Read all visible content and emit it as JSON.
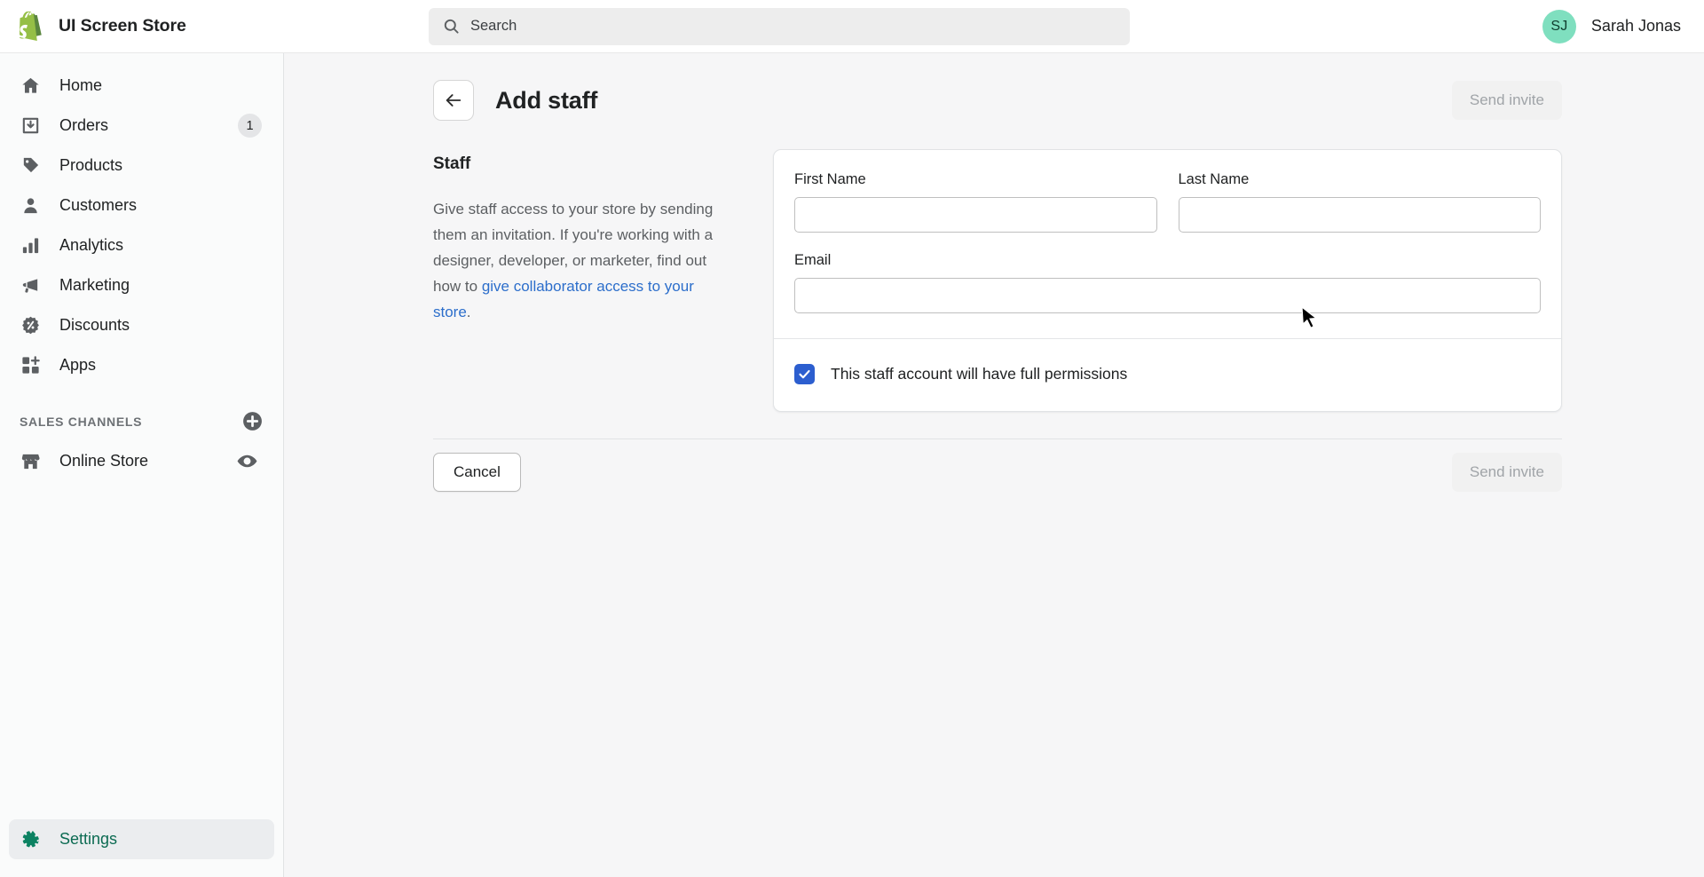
{
  "topbar": {
    "brand_name": "UI Screen Store",
    "logo_icon": "shopify-bag-icon",
    "search": {
      "placeholder": "Search",
      "value": "",
      "icon": "search-icon"
    },
    "user": {
      "initials": "SJ",
      "name": "Sarah Jonas",
      "avatar_color": "#7fdfbf"
    }
  },
  "sidebar": {
    "items": [
      {
        "label": "Home",
        "icon": "home-icon",
        "badge": null
      },
      {
        "label": "Orders",
        "icon": "orders-inbox-icon",
        "badge": "1"
      },
      {
        "label": "Products",
        "icon": "tag-icon",
        "badge": null
      },
      {
        "label": "Customers",
        "icon": "person-icon",
        "badge": null
      },
      {
        "label": "Analytics",
        "icon": "bar-chart-icon",
        "badge": null
      },
      {
        "label": "Marketing",
        "icon": "megaphone-icon",
        "badge": null
      },
      {
        "label": "Discounts",
        "icon": "discount-badge-icon",
        "badge": null
      },
      {
        "label": "Apps",
        "icon": "apps-grid-icon",
        "badge": null
      }
    ],
    "section": {
      "title": "SALES CHANNELS",
      "add_icon": "plus-circle-icon",
      "channels": [
        {
          "label": "Online Store",
          "icon": "storefront-icon",
          "action_icon": "eye-icon"
        }
      ]
    },
    "settings": {
      "label": "Settings",
      "icon": "gear-icon",
      "active": true,
      "active_color": "#0c6b52"
    }
  },
  "page": {
    "back_icon": "arrow-left-icon",
    "title": "Add staff",
    "send_invite_top": "Send invite",
    "left": {
      "heading": "Staff",
      "description_before": "Give staff access to your store by sending them an invitation. If you're working with a designer, developer, or marketer, find out how to ",
      "link_text": "give collaborator access to your store",
      "description_after": "."
    },
    "form": {
      "fields": [
        {
          "label": "First Name",
          "value": "",
          "placeholder": ""
        },
        {
          "label": "Last Name",
          "value": "",
          "placeholder": ""
        }
      ],
      "email": {
        "label": "Email",
        "value": "",
        "placeholder": ""
      },
      "checkbox": {
        "label": "This staff account will have full permissions",
        "checked": true,
        "color": "#2c5ecf"
      }
    },
    "footer": {
      "cancel": "Cancel",
      "send_invite": "Send invite"
    }
  }
}
